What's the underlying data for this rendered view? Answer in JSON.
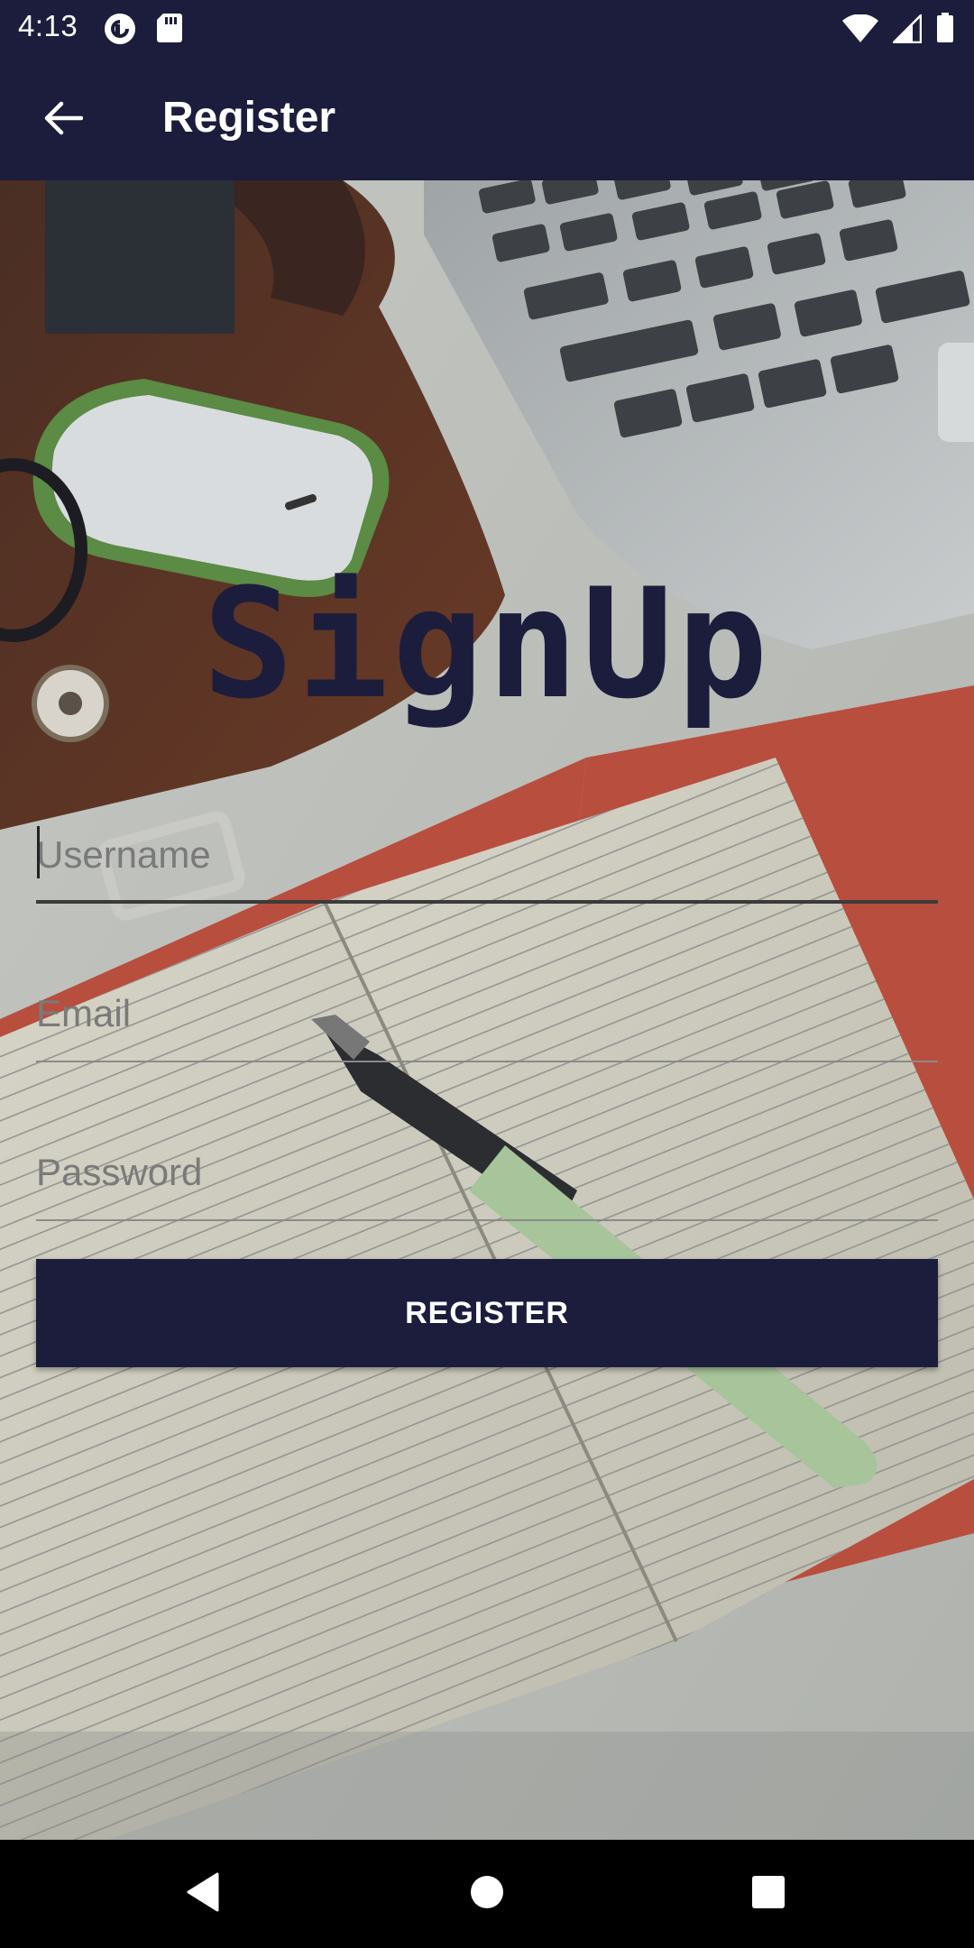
{
  "status_bar": {
    "time": "4:13",
    "left_icons": [
      "pocket-casts-icon",
      "sd-card-icon"
    ],
    "right_icons": [
      "wifi-icon",
      "cell-signal-icon",
      "battery-icon"
    ]
  },
  "app_bar": {
    "title": "Register",
    "back_icon": "arrow-left-icon"
  },
  "form": {
    "heading": "SignUp",
    "username": {
      "placeholder": "Username",
      "value": ""
    },
    "email": {
      "placeholder": "Email",
      "value": ""
    },
    "password": {
      "placeholder": "Password",
      "value": ""
    },
    "submit_label": "REGISTER"
  },
  "nav_bar": {
    "buttons": [
      "back-triangle-icon",
      "home-circle-icon",
      "recents-square-icon"
    ]
  },
  "colors": {
    "primary": "#1c1d3c",
    "on_primary": "#ffffff",
    "hint": "#7a7a7a"
  }
}
